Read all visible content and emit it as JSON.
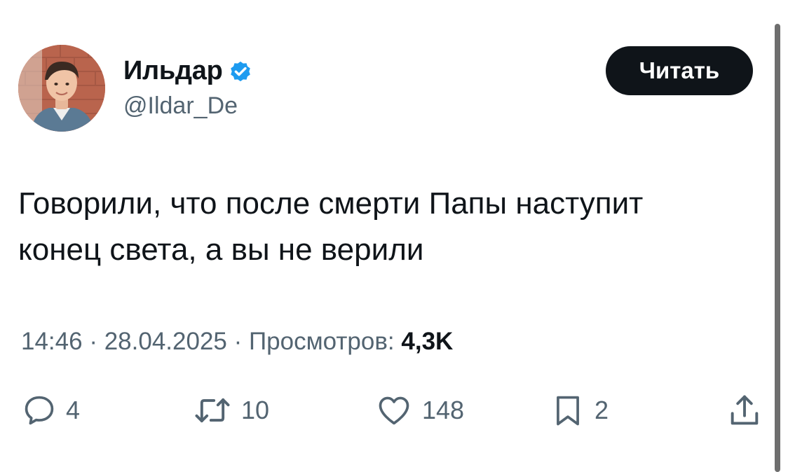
{
  "author": {
    "display_name": "Ильдар",
    "handle": "@Ildar_De",
    "verified": true
  },
  "header": {
    "read_button_label": "Читать"
  },
  "tweet": {
    "text_line1": "Говорили, что после смерти Папы наступит",
    "text_line2": "конец света, а вы не верили"
  },
  "meta": {
    "time": "14:46",
    "separator": "·",
    "date": "28.04.2025",
    "views_label": "Просмотров:",
    "views_count": "4,3K"
  },
  "actions": {
    "replies": "4",
    "reposts": "10",
    "likes": "148",
    "bookmarks": "2"
  },
  "colors": {
    "verified": "#1d9bf0",
    "text_primary": "#0f1419",
    "text_secondary": "#536471",
    "button_bg": "#0f1419"
  },
  "icons": {
    "reply": "speech-bubble-icon",
    "repost": "repost-arrows-icon",
    "like": "heart-icon",
    "bookmark": "bookmark-icon",
    "share": "share-upload-icon",
    "verified": "verified-badge-icon"
  }
}
